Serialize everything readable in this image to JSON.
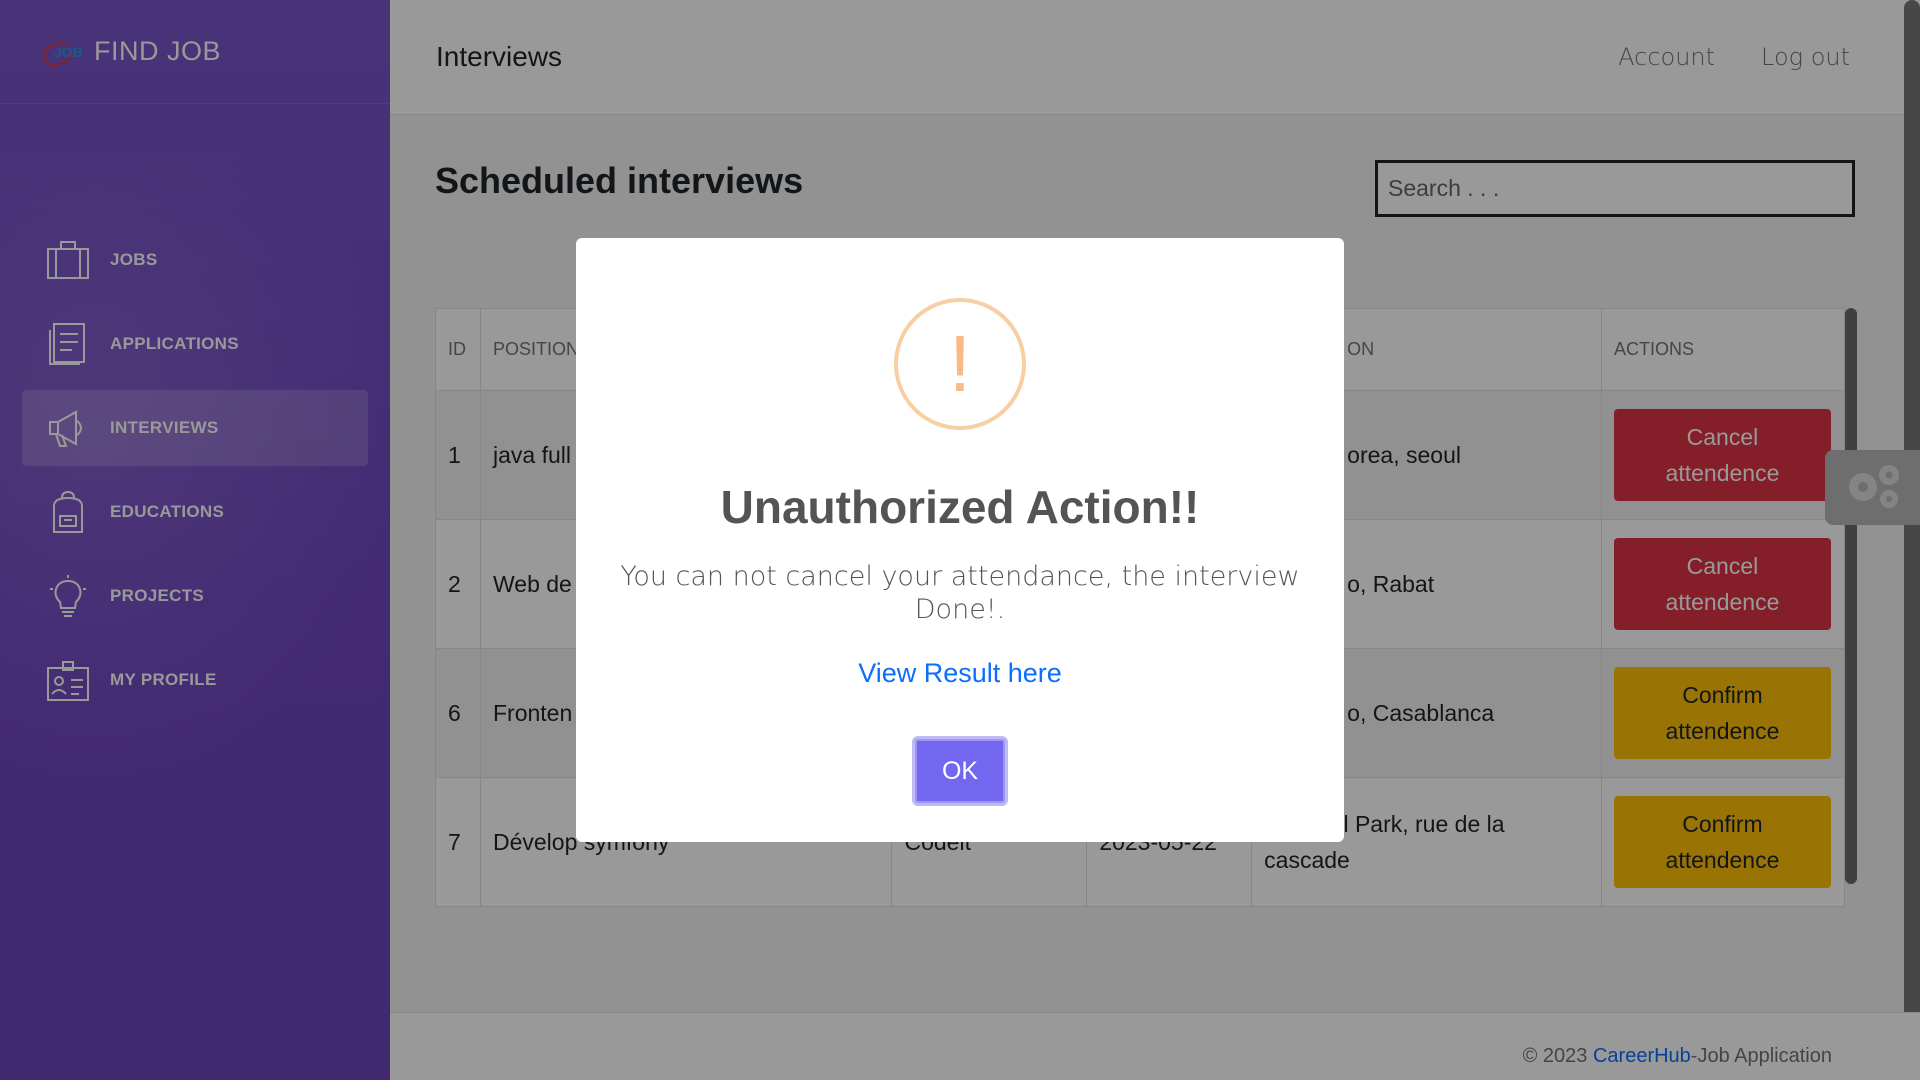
{
  "brand": {
    "logo_text": "JOB",
    "name": "FIND JOB"
  },
  "sidebar": {
    "items": [
      {
        "label": "JOBS",
        "icon": "briefcase-icon",
        "active": false
      },
      {
        "label": "APPLICATIONS",
        "icon": "document-icon",
        "active": false
      },
      {
        "label": "INTERVIEWS",
        "icon": "megaphone-icon",
        "active": true
      },
      {
        "label": "EDUCATIONS",
        "icon": "backpack-icon",
        "active": false
      },
      {
        "label": "PROJECTS",
        "icon": "lightbulb-icon",
        "active": false
      },
      {
        "label": "MY PROFILE",
        "icon": "id-card-icon",
        "active": false
      }
    ]
  },
  "topbar": {
    "title": "Interviews",
    "account": "Account",
    "logout": "Log out"
  },
  "main": {
    "section_title": "Scheduled interviews",
    "search_placeholder": "Search . . ."
  },
  "table": {
    "headers": {
      "id": "ID",
      "position": "POSITION",
      "location_tail": "ON",
      "actions": "ACTIONS"
    },
    "rows": [
      {
        "id": "1",
        "position": "java full",
        "location": "orea, seoul",
        "action": "Cancel attendence"
      },
      {
        "id": "2",
        "position": "Web de",
        "location": "o, Rabat",
        "action": "Cancel attendence"
      },
      {
        "id": "6",
        "position": "Fronten Angular",
        "location": "o, Casablanca",
        "action": "Confirm attendence"
      },
      {
        "id": "7",
        "position": "Dévelop symfony",
        "company": "Codeit",
        "date": "2023-05-22",
        "location": "National Park, rue de la cascade",
        "action": "Confirm attendence"
      }
    ]
  },
  "footer": {
    "prefix": "© 2023 ",
    "link": "CareerHub",
    "suffix": "-Job Application"
  },
  "modal": {
    "icon": "warning-icon",
    "mark": "!",
    "title": "Unauthorized Action!!",
    "text": "You can not cancel your attendance, the interview Done!.",
    "link": "View Result here",
    "ok": "OK"
  },
  "colors": {
    "sidebar": "#7047c0",
    "cancel": "#dc3545",
    "confirm": "#ffc107",
    "ok_button": "#7367f0",
    "warning": "#f8bb86"
  }
}
